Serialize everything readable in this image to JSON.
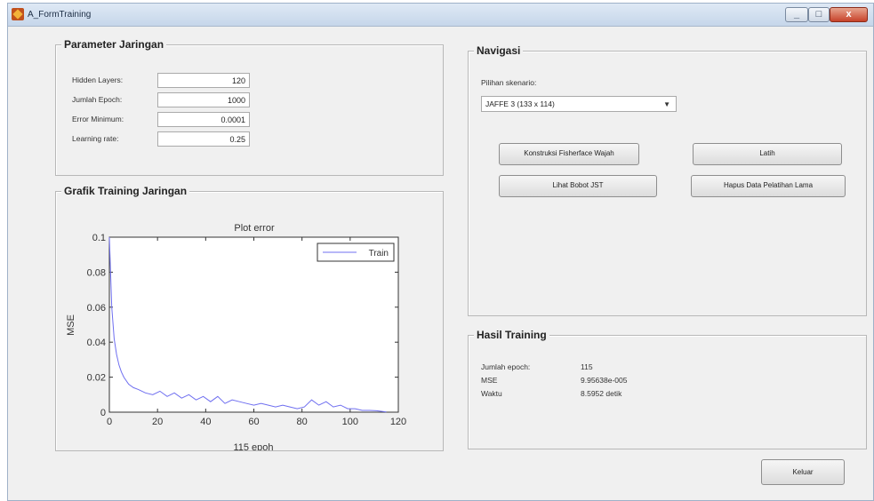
{
  "window": {
    "title": "A_FormTraining",
    "controls": [
      "_",
      "□",
      "x"
    ]
  },
  "parameter_panel": {
    "title": "Parameter Jaringan",
    "fields": [
      {
        "label": "Hidden Layers:",
        "value": "120"
      },
      {
        "label": "Jumlah Epoch:",
        "value": "1000"
      },
      {
        "label": "Error Minimum:",
        "value": "0.0001"
      },
      {
        "label": "Learning rate:",
        "value": "0.25"
      }
    ]
  },
  "graph_panel": {
    "title": "Grafik Training Jaringan"
  },
  "chart_data": {
    "type": "line",
    "title": "Plot error",
    "xlabel": "115 epoh",
    "ylabel": "MSE",
    "xlim": [
      0,
      120
    ],
    "ylim": [
      0,
      0.1
    ],
    "xticks": [
      "0",
      "20",
      "40",
      "60",
      "80",
      "100",
      "120"
    ],
    "yticks": [
      "0",
      "0.02",
      "0.04",
      "0.06",
      "0.08",
      "0.1"
    ],
    "legend_position": "top-right",
    "series": [
      {
        "name": "Train",
        "color": "#6f6ff0",
        "x": [
          0,
          1,
          2,
          3,
          4,
          5,
          6,
          8,
          10,
          12,
          15,
          18,
          21,
          24,
          27,
          30,
          33,
          36,
          39,
          42,
          45,
          48,
          51,
          54,
          57,
          60,
          63,
          66,
          69,
          72,
          75,
          78,
          81,
          84,
          87,
          90,
          93,
          96,
          99,
          102,
          105,
          108,
          111,
          115
        ],
        "y": [
          0.1,
          0.06,
          0.042,
          0.033,
          0.027,
          0.023,
          0.02,
          0.016,
          0.014,
          0.013,
          0.011,
          0.01,
          0.012,
          0.009,
          0.011,
          0.008,
          0.01,
          0.007,
          0.009,
          0.006,
          0.009,
          0.005,
          0.007,
          0.006,
          0.005,
          0.004,
          0.005,
          0.004,
          0.003,
          0.004,
          0.003,
          0.002,
          0.003,
          0.007,
          0.004,
          0.006,
          0.003,
          0.004,
          0.002,
          0.002,
          0.001,
          0.001,
          0.0008,
          0.0001
        ]
      }
    ]
  },
  "navigasi_panel": {
    "title": "Navigasi",
    "select_label": "Pilihan skenario:",
    "select_value": "JAFFE 3 (133 x 114)",
    "buttons": {
      "fisherface": "Konstruksi Fisherface Wajah",
      "latih": "Latih",
      "bobot": "Lihat Bobot JST",
      "hapus": "Hapus Data Pelatihan Lama"
    }
  },
  "hasil_panel": {
    "title": "Hasil Training",
    "rows": [
      {
        "label": "Jumlah epoch:",
        "value": "115"
      },
      {
        "label": "MSE",
        "value": "9.95638e-005"
      },
      {
        "label": "Waktu",
        "value": "8.5952 detik"
      }
    ]
  },
  "footer": {
    "exit_label": "Keluar"
  }
}
